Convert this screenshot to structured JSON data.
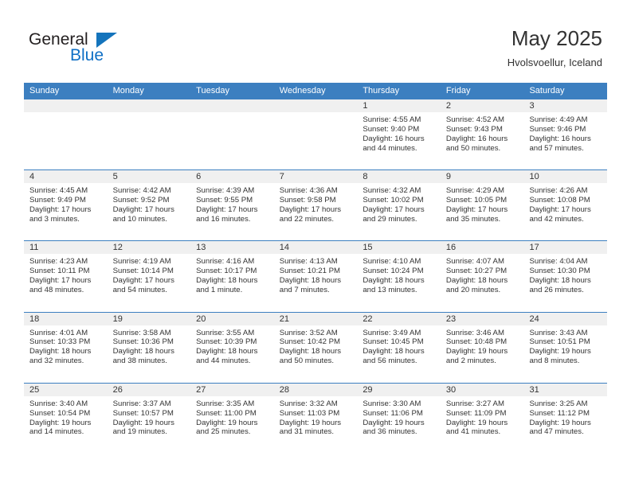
{
  "brand": {
    "name_top": "General",
    "name_bottom": "Blue",
    "color_blue": "#1474bc",
    "color_dark": "#231f20"
  },
  "header": {
    "title": "May 2025",
    "location": "Hvolsvoellur, Iceland"
  },
  "calendar": {
    "header_color": "#3c7fc0",
    "day_band_color": "#f0f0f0",
    "weekdays": [
      "Sunday",
      "Monday",
      "Tuesday",
      "Wednesday",
      "Thursday",
      "Friday",
      "Saturday"
    ],
    "labels": {
      "sunrise": "Sunrise:",
      "sunset": "Sunset:",
      "daylight": "Daylight:"
    },
    "weeks": [
      [
        {
          "day": "",
          "empty": true
        },
        {
          "day": "",
          "empty": true
        },
        {
          "day": "",
          "empty": true
        },
        {
          "day": "",
          "empty": true
        },
        {
          "day": "1",
          "sunrise": "Sunrise: 4:55 AM",
          "sunset": "Sunset: 9:40 PM",
          "daylight": "Daylight: 16 hours and 44 minutes."
        },
        {
          "day": "2",
          "sunrise": "Sunrise: 4:52 AM",
          "sunset": "Sunset: 9:43 PM",
          "daylight": "Daylight: 16 hours and 50 minutes."
        },
        {
          "day": "3",
          "sunrise": "Sunrise: 4:49 AM",
          "sunset": "Sunset: 9:46 PM",
          "daylight": "Daylight: 16 hours and 57 minutes."
        }
      ],
      [
        {
          "day": "4",
          "sunrise": "Sunrise: 4:45 AM",
          "sunset": "Sunset: 9:49 PM",
          "daylight": "Daylight: 17 hours and 3 minutes."
        },
        {
          "day": "5",
          "sunrise": "Sunrise: 4:42 AM",
          "sunset": "Sunset: 9:52 PM",
          "daylight": "Daylight: 17 hours and 10 minutes."
        },
        {
          "day": "6",
          "sunrise": "Sunrise: 4:39 AM",
          "sunset": "Sunset: 9:55 PM",
          "daylight": "Daylight: 17 hours and 16 minutes."
        },
        {
          "day": "7",
          "sunrise": "Sunrise: 4:36 AM",
          "sunset": "Sunset: 9:58 PM",
          "daylight": "Daylight: 17 hours and 22 minutes."
        },
        {
          "day": "8",
          "sunrise": "Sunrise: 4:32 AM",
          "sunset": "Sunset: 10:02 PM",
          "daylight": "Daylight: 17 hours and 29 minutes."
        },
        {
          "day": "9",
          "sunrise": "Sunrise: 4:29 AM",
          "sunset": "Sunset: 10:05 PM",
          "daylight": "Daylight: 17 hours and 35 minutes."
        },
        {
          "day": "10",
          "sunrise": "Sunrise: 4:26 AM",
          "sunset": "Sunset: 10:08 PM",
          "daylight": "Daylight: 17 hours and 42 minutes."
        }
      ],
      [
        {
          "day": "11",
          "sunrise": "Sunrise: 4:23 AM",
          "sunset": "Sunset: 10:11 PM",
          "daylight": "Daylight: 17 hours and 48 minutes."
        },
        {
          "day": "12",
          "sunrise": "Sunrise: 4:19 AM",
          "sunset": "Sunset: 10:14 PM",
          "daylight": "Daylight: 17 hours and 54 minutes."
        },
        {
          "day": "13",
          "sunrise": "Sunrise: 4:16 AM",
          "sunset": "Sunset: 10:17 PM",
          "daylight": "Daylight: 18 hours and 1 minute."
        },
        {
          "day": "14",
          "sunrise": "Sunrise: 4:13 AM",
          "sunset": "Sunset: 10:21 PM",
          "daylight": "Daylight: 18 hours and 7 minutes."
        },
        {
          "day": "15",
          "sunrise": "Sunrise: 4:10 AM",
          "sunset": "Sunset: 10:24 PM",
          "daylight": "Daylight: 18 hours and 13 minutes."
        },
        {
          "day": "16",
          "sunrise": "Sunrise: 4:07 AM",
          "sunset": "Sunset: 10:27 PM",
          "daylight": "Daylight: 18 hours and 20 minutes."
        },
        {
          "day": "17",
          "sunrise": "Sunrise: 4:04 AM",
          "sunset": "Sunset: 10:30 PM",
          "daylight": "Daylight: 18 hours and 26 minutes."
        }
      ],
      [
        {
          "day": "18",
          "sunrise": "Sunrise: 4:01 AM",
          "sunset": "Sunset: 10:33 PM",
          "daylight": "Daylight: 18 hours and 32 minutes."
        },
        {
          "day": "19",
          "sunrise": "Sunrise: 3:58 AM",
          "sunset": "Sunset: 10:36 PM",
          "daylight": "Daylight: 18 hours and 38 minutes."
        },
        {
          "day": "20",
          "sunrise": "Sunrise: 3:55 AM",
          "sunset": "Sunset: 10:39 PM",
          "daylight": "Daylight: 18 hours and 44 minutes."
        },
        {
          "day": "21",
          "sunrise": "Sunrise: 3:52 AM",
          "sunset": "Sunset: 10:42 PM",
          "daylight": "Daylight: 18 hours and 50 minutes."
        },
        {
          "day": "22",
          "sunrise": "Sunrise: 3:49 AM",
          "sunset": "Sunset: 10:45 PM",
          "daylight": "Daylight: 18 hours and 56 minutes."
        },
        {
          "day": "23",
          "sunrise": "Sunrise: 3:46 AM",
          "sunset": "Sunset: 10:48 PM",
          "daylight": "Daylight: 19 hours and 2 minutes."
        },
        {
          "day": "24",
          "sunrise": "Sunrise: 3:43 AM",
          "sunset": "Sunset: 10:51 PM",
          "daylight": "Daylight: 19 hours and 8 minutes."
        }
      ],
      [
        {
          "day": "25",
          "sunrise": "Sunrise: 3:40 AM",
          "sunset": "Sunset: 10:54 PM",
          "daylight": "Daylight: 19 hours and 14 minutes."
        },
        {
          "day": "26",
          "sunrise": "Sunrise: 3:37 AM",
          "sunset": "Sunset: 10:57 PM",
          "daylight": "Daylight: 19 hours and 19 minutes."
        },
        {
          "day": "27",
          "sunrise": "Sunrise: 3:35 AM",
          "sunset": "Sunset: 11:00 PM",
          "daylight": "Daylight: 19 hours and 25 minutes."
        },
        {
          "day": "28",
          "sunrise": "Sunrise: 3:32 AM",
          "sunset": "Sunset: 11:03 PM",
          "daylight": "Daylight: 19 hours and 31 minutes."
        },
        {
          "day": "29",
          "sunrise": "Sunrise: 3:30 AM",
          "sunset": "Sunset: 11:06 PM",
          "daylight": "Daylight: 19 hours and 36 minutes."
        },
        {
          "day": "30",
          "sunrise": "Sunrise: 3:27 AM",
          "sunset": "Sunset: 11:09 PM",
          "daylight": "Daylight: 19 hours and 41 minutes."
        },
        {
          "day": "31",
          "sunrise": "Sunrise: 3:25 AM",
          "sunset": "Sunset: 11:12 PM",
          "daylight": "Daylight: 19 hours and 47 minutes."
        }
      ]
    ]
  }
}
